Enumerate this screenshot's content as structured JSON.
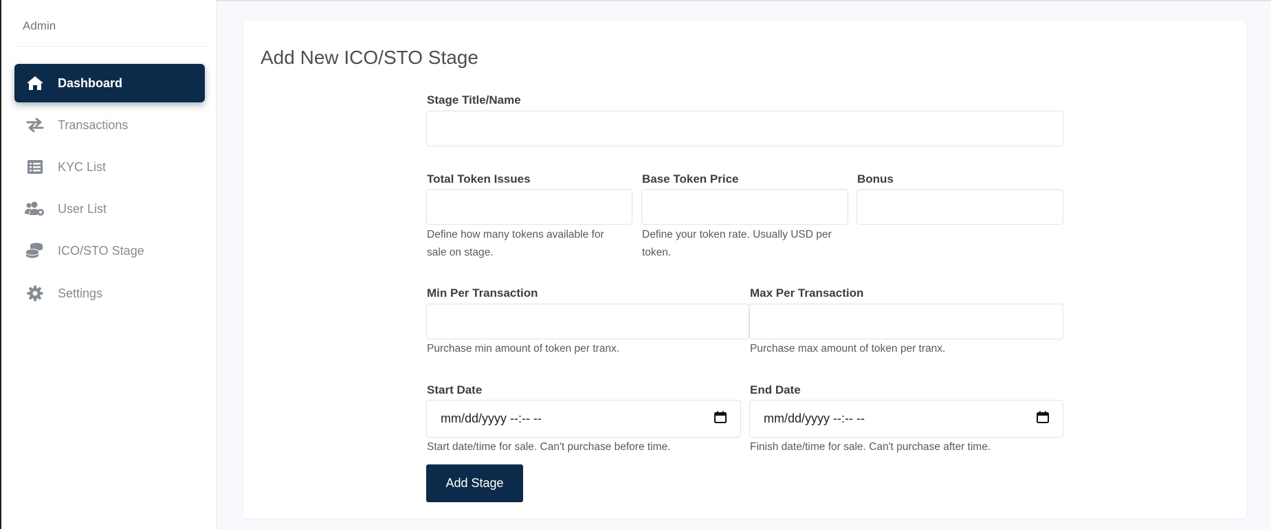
{
  "sidebar": {
    "brand": "Admin",
    "items": [
      {
        "label": "Dashboard",
        "icon": "home-icon",
        "active": true
      },
      {
        "label": "Transactions",
        "icon": "exchange-icon",
        "active": false
      },
      {
        "label": "KYC List",
        "icon": "list-icon",
        "active": false
      },
      {
        "label": "User List",
        "icon": "users-cog-icon",
        "active": false
      },
      {
        "label": "ICO/STO Stage",
        "icon": "coins-icon",
        "active": false
      },
      {
        "label": "Settings",
        "icon": "gear-icon",
        "active": false
      }
    ]
  },
  "main": {
    "title": "Add New ICO/STO Stage",
    "fields": {
      "stage_title": {
        "label": "Stage Title/Name",
        "value": ""
      },
      "total_token": {
        "label": "Total Token Issues",
        "value": "",
        "help": "Define how many tokens available for sale on stage."
      },
      "base_price": {
        "label": "Base Token Price",
        "value": "",
        "help": "Define your token rate. Usually USD per token."
      },
      "bonus": {
        "label": "Bonus",
        "value": ""
      },
      "min_per_tx": {
        "label": "Min Per Transaction",
        "value": "",
        "help": "Purchase min amount of token per tranx."
      },
      "max_per_tx": {
        "label": "Max Per Transaction",
        "value": "",
        "help": "Purchase max amount of token per tranx."
      },
      "start_date": {
        "label": "Start Date",
        "placeholder": "mm/dd/yyyy --:-- --",
        "help": "Start date/time for sale. Can't purchase before time."
      },
      "end_date": {
        "label": "End Date",
        "placeholder": "mm/dd/yyyy --:-- --",
        "help": "Finish date/time for sale. Can't purchase after time."
      }
    },
    "submit_label": "Add Stage"
  },
  "colors": {
    "primary": "#0c2b4a",
    "sidebar_text": "#858b93",
    "page_background": "#f8f9fc"
  }
}
